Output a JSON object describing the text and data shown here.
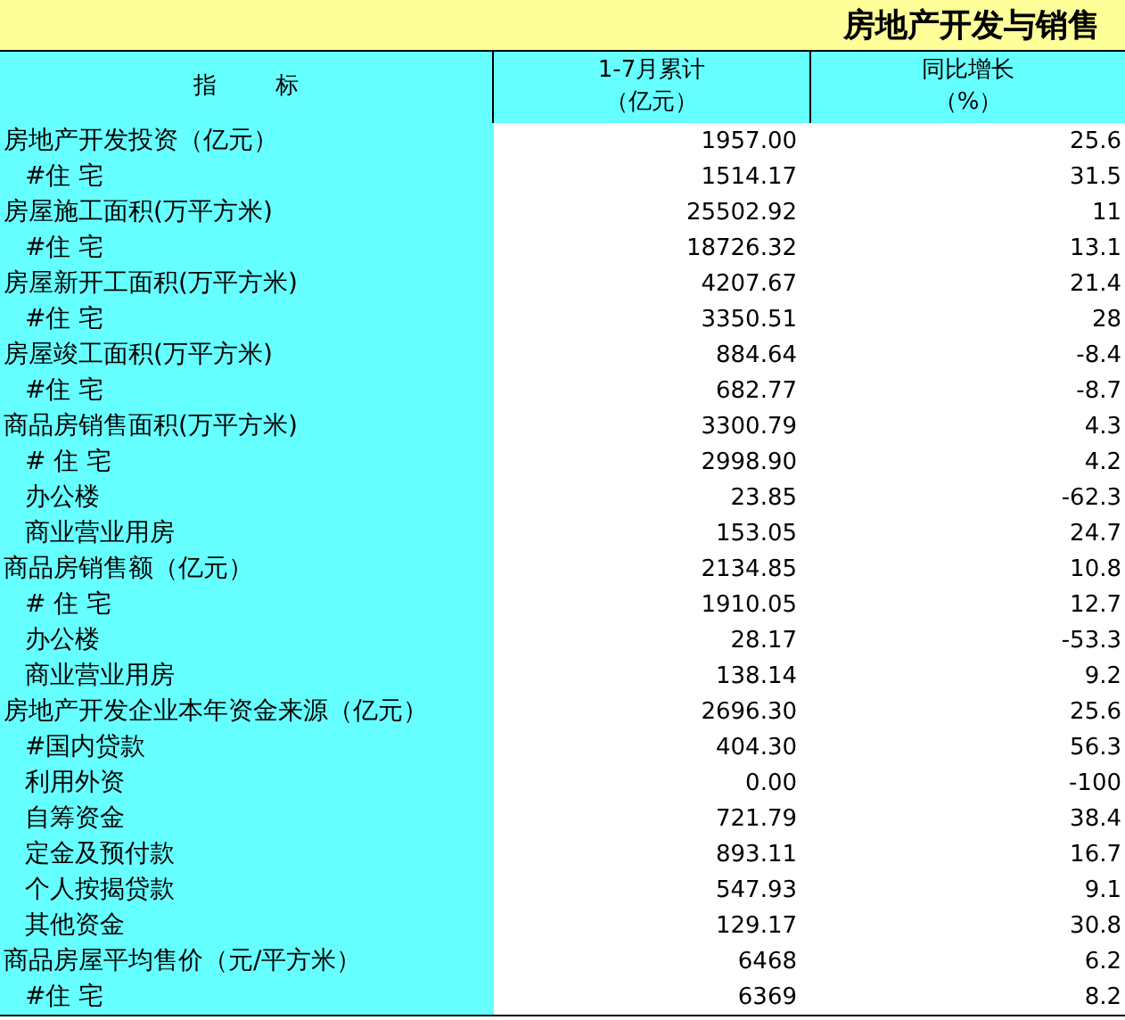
{
  "title": "房地产开发与销售",
  "table": {
    "columns": [
      {
        "label": "指        标"
      },
      {
        "label": "1-7月累计",
        "unit": "（亿元）"
      },
      {
        "label": "同比增长",
        "unit": "（%）"
      }
    ],
    "rows": [
      {
        "label": "房地产开发投资（亿元）",
        "cumulative": "1957.00",
        "growth": "25.6",
        "children": [
          {
            "label": "#住 宅",
            "cumulative": "1514.17",
            "growth": "31.5"
          }
        ]
      },
      {
        "label": "房屋施工面积(万平方米)",
        "cumulative": "25502.92",
        "growth": "11",
        "children": [
          {
            "label": "#住 宅",
            "cumulative": "18726.32",
            "growth": "13.1"
          }
        ]
      },
      {
        "label": "房屋新开工面积(万平方米)",
        "cumulative": "4207.67",
        "growth": "21.4",
        "children": [
          {
            "label": "#住 宅",
            "cumulative": "3350.51",
            "growth": "28"
          }
        ]
      },
      {
        "label": "房屋竣工面积(万平方米)",
        "cumulative": "884.64",
        "growth": "-8.4",
        "children": [
          {
            "label": "#住 宅",
            "cumulative": "682.77",
            "growth": "-8.7"
          }
        ]
      },
      {
        "label": "商品房销售面积(万平方米)",
        "cumulative": "3300.79",
        "growth": "4.3",
        "children": [
          {
            "label": "# 住 宅",
            "cumulative": "2998.90",
            "growth": "4.2"
          },
          {
            "label": "办公楼",
            "cumulative": "23.85",
            "growth": "-62.3"
          },
          {
            "label": "商业营业用房",
            "cumulative": "153.05",
            "growth": "24.7"
          }
        ]
      },
      {
        "label": "商品房销售额（亿元）",
        "cumulative": "2134.85",
        "growth": "10.8",
        "children": [
          {
            "label": "# 住 宅",
            "cumulative": "1910.05",
            "growth": "12.7"
          },
          {
            "label": "办公楼",
            "cumulative": "28.17",
            "growth": "-53.3"
          },
          {
            "label": "商业营业用房",
            "cumulative": "138.14",
            "growth": "9.2"
          }
        ]
      },
      {
        "label": "房地产开发企业本年资金来源（亿元）",
        "cumulative": "2696.30",
        "growth": "25.6",
        "children": [
          {
            "label": "#国内贷款",
            "cumulative": "404.30",
            "growth": "56.3"
          },
          {
            "label": "利用外资",
            "cumulative": "0.00",
            "growth": "-100"
          },
          {
            "label": "自筹资金",
            "cumulative": "721.79",
            "growth": "38.4"
          },
          {
            "label": "定金及预付款",
            "cumulative": "893.11",
            "growth": "16.7"
          },
          {
            "label": "个人按揭贷款",
            "cumulative": "547.93",
            "growth": "9.1"
          },
          {
            "label": "其他资金",
            "cumulative": "129.17",
            "growth": "30.8"
          }
        ]
      },
      {
        "label": "商品房屋平均售价（元/平方米）",
        "cumulative": "6468",
        "growth": "6.2",
        "children": [
          {
            "label": "#住 宅",
            "cumulative": "6369",
            "growth": "8.2"
          }
        ]
      }
    ]
  }
}
